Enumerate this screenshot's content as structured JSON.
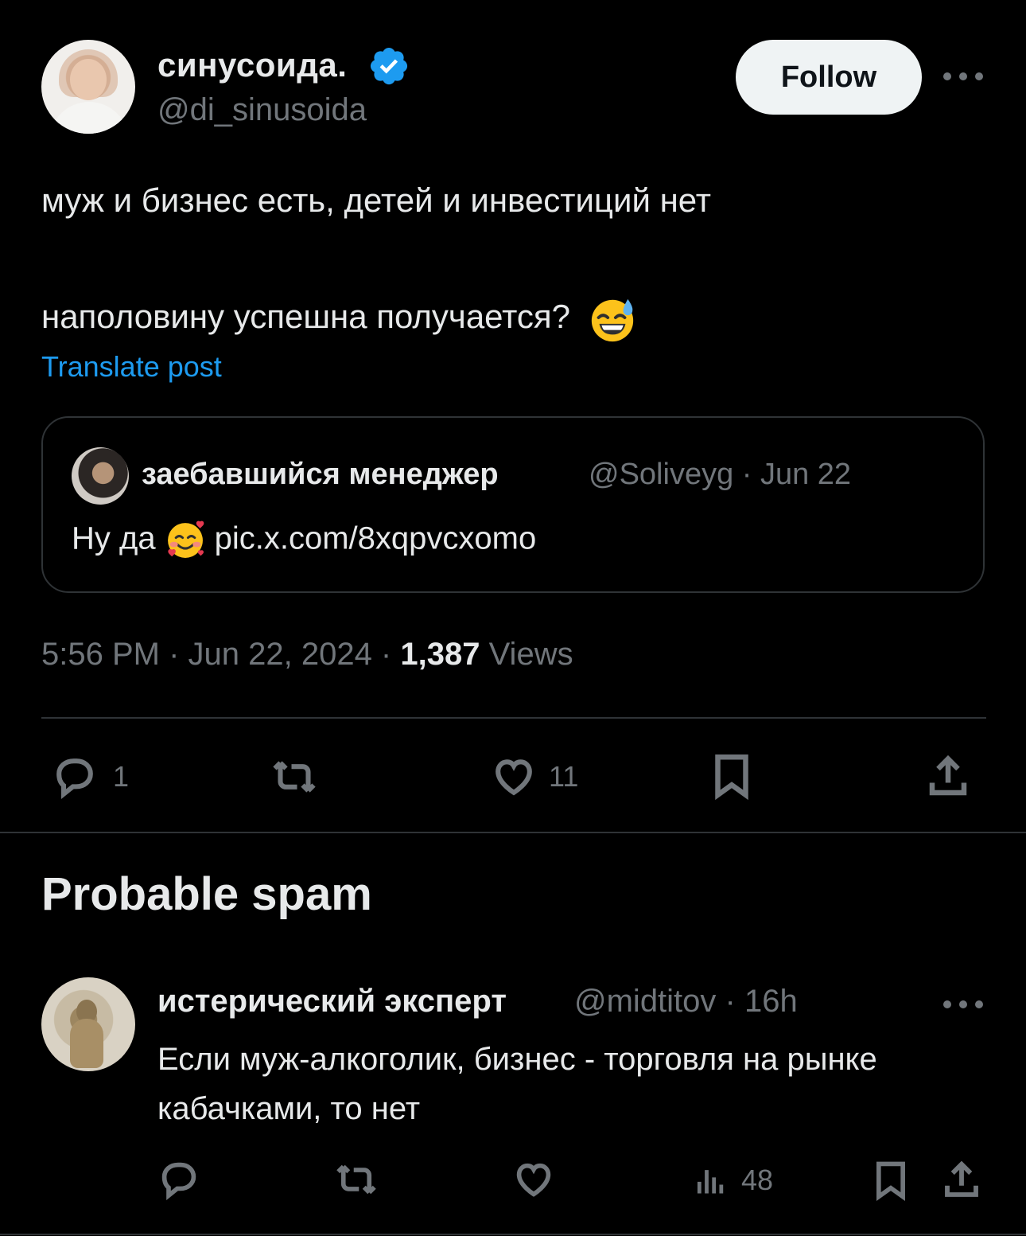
{
  "post": {
    "display_name": "синусоида.",
    "handle": "@di_sinusoida",
    "follow_label": "Follow",
    "text_line1": "муж и бизнес есть, детей и инвестиций нет",
    "text_line2": "наполовину успешна получается?",
    "emoji_icon": "grinning-sweat-emoji",
    "translate_label": "Translate post",
    "quote": {
      "display_name": "заебавшийся менеджер",
      "meta": "@Soliveyg · Jun 22",
      "text": "Ну да",
      "emoji_icon": "smiling-face-with-hearts-emoji",
      "link": "pic.x.com/8xqpvcxomo"
    },
    "time": "5:56 PM · Jun 22, 2024 · ",
    "views_count": "1,387",
    "views_label": " Views",
    "actions": {
      "replies": "1",
      "reposts": "",
      "likes": "11"
    }
  },
  "section_title": "Probable spam",
  "reply": {
    "display_name": "истерический эксперт",
    "meta": "@midtitov · 16h",
    "text": "Если муж-алкоголик, бизнес - торговля на рынке кабачками, то нет",
    "views": "48"
  },
  "colors": {
    "background": "#000000",
    "text": "#e7e9ea",
    "muted": "#71767b",
    "accent": "#1d9bf0",
    "border": "#2f3336"
  }
}
